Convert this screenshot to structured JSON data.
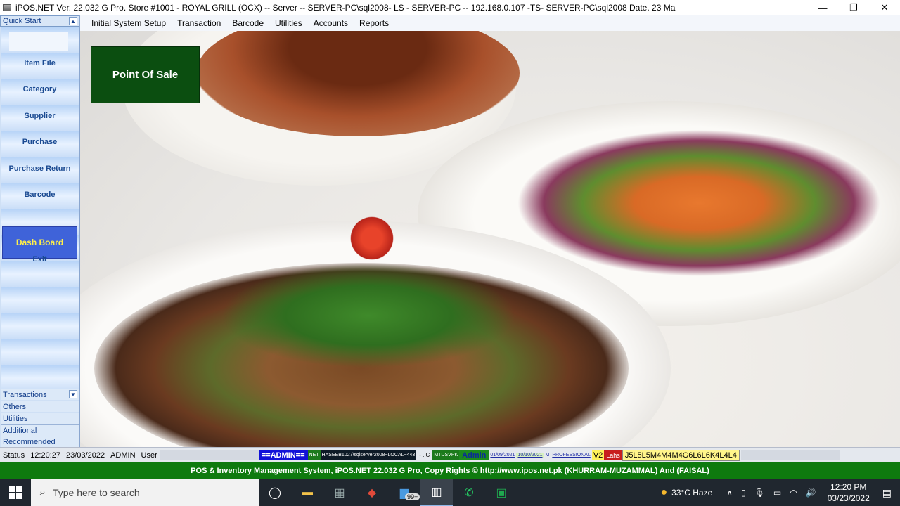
{
  "window": {
    "title": "iPOS.NET Ver. 22.032 G Pro. Store #1001 - ROYAL GRILL (OCX) -- Server -- SERVER-PC\\sql2008- LS - SERVER-PC -- 192.168.0.107 -TS- SERVER-PC\\sql2008 Date.  23 Ma",
    "minimize": "—",
    "restore": "❐",
    "close": "✕"
  },
  "menu": {
    "items": [
      "Initial System Setup",
      "Transaction",
      "Barcode",
      "Utilities",
      "Accounts",
      "Reports"
    ]
  },
  "sidebar": {
    "header": "Quick Start",
    "items": [
      "Item File",
      "Category",
      "Supplier",
      "Purchase",
      "Purchase Return",
      "Barcode"
    ],
    "active": "Dash Board",
    "exit": "Exit",
    "groups": [
      "Transactions",
      "Others",
      "Utilities",
      "Additional",
      "Recommended"
    ]
  },
  "main": {
    "pos_button": "Point Of Sale"
  },
  "status": {
    "label": "Status",
    "time": "12:20:27",
    "date": "23/03/2022",
    "user": "ADMIN",
    "role": "User",
    "admin_badge": "==ADMIN==",
    "net": "NET",
    "server_path": "HASEEB1027\\sqlserver2008~LOCAL~443",
    "sep": "- . C",
    "code": "MTDSVPK",
    "admin_name": "Admin",
    "date1": "01/09/2021",
    "date2": "10/10/2021",
    "m": "M",
    "edition": "PROFESSIONAL",
    "version": "V2",
    "flag": "Lahs",
    "license": "J5L5L5M4M4M4G6L6L6K4L4L4"
  },
  "footer": {
    "text": "POS  & Inventory Management System,  iPOS.NET 22.032 G Pro, Copy Rights © http://www.ipos.net.pk   (KHURRAM-MUZAMMAL) And (FAISAL)"
  },
  "taskbar": {
    "search_placeholder": "Type here to search",
    "badge": "99+",
    "weather": "33°C  Haze",
    "time": "12:20 PM",
    "date": "03/23/2022"
  }
}
